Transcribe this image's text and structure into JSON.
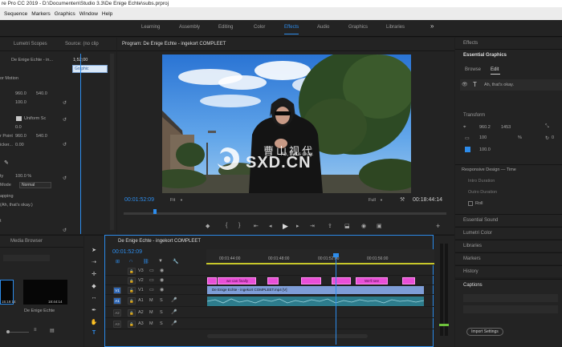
{
  "title_bar": {
    "text": "re Pro CC 2019 - D:\\Documenten\\Studio 3.3\\De Enige Echte\\subs.prproj"
  },
  "menu": [
    "Sequence",
    "Markers",
    "Graphics",
    "Window",
    "Help"
  ],
  "workspaces": [
    {
      "label": "Learning"
    },
    {
      "label": "Assembly"
    },
    {
      "label": "Editing"
    },
    {
      "label": "Color"
    },
    {
      "label": "Effects"
    },
    {
      "label": "Audio"
    },
    {
      "label": "Graphics"
    },
    {
      "label": "Libraries"
    }
  ],
  "more_glyph": "»",
  "effect_controls": {
    "tabs": [
      "Lumetri Scopes",
      "Source: (no clip"
    ],
    "clip_name": "De Enige Echte - in...",
    "timecode": "1;52;00",
    "tooltip": "Graphic",
    "rows": [
      {
        "label": "or Motion"
      },
      {
        "label": "",
        "v1": "960.0",
        "v2": "540.0"
      },
      {
        "label": "",
        "v1": "100.0"
      },
      {
        "label": "",
        "v1": ""
      },
      {
        "label": "",
        "check": "Uniform Sc"
      },
      {
        "label": "",
        "v1": "0.0"
      },
      {
        "label": "r Point",
        "v1": "960.0",
        "v2": "540.0"
      },
      {
        "label": "icker...",
        "v1": "0.00"
      },
      {
        "label": ""
      },
      {
        "label": "ty"
      },
      {
        "label": "",
        "v1": "100.0 %"
      },
      {
        "label": "Mode",
        "v1": "Normal"
      },
      {
        "label": "apping"
      },
      {
        "label": "(Ah, that's okay.)"
      },
      {
        "label": "t"
      }
    ]
  },
  "program": {
    "title": "Program: De Enige Echte - ingekort COMPLEET",
    "timecode_left": "00:01:52:09",
    "fit": "Fit",
    "quality": "Full",
    "timecode_right": "00:18:44:14",
    "watermark_main": "SXD.CN",
    "watermark_cn": "曹山视代",
    "watermark_sub": "Ah, that's okay."
  },
  "effects_panel": {
    "title": "Effects"
  },
  "essential_graphics": {
    "title": "Essential Graphics",
    "tabs": [
      "Browse",
      "Edit"
    ],
    "layer_text": "Ah, that's okay.",
    "transform_label": "Transform",
    "pos_x": "960.2",
    "pos_y": "1453",
    "rot": "0",
    "scale": "100",
    "pct": "%",
    "duration_val": "100.0",
    "responsive_label": "Responsive Design — Time",
    "intro": "Intro Duration",
    "outro": "Outro Duration",
    "roll": "Roll"
  },
  "right_list": [
    "Essential Sound",
    "Lumetri Color",
    "Libraries",
    "Markers",
    "History"
  ],
  "captions": {
    "title": "Captions",
    "import": "Import Settings"
  },
  "project_panel": {
    "tab": "Media Browser",
    "thumb1_label": "",
    "thumb2_label": "De Enige Echte",
    "thumb1_dur": "15:19:14",
    "thumb2_dur": "18:44:14"
  },
  "timeline": {
    "title": "De Enige Echte - ingekort COMPLEET",
    "timecode": "00:01:52:09",
    "ruler": [
      "00:01:44:00",
      "00:01:48:00",
      "00:01:52:00",
      "00:01:56:00"
    ],
    "tracks_v": [
      "V3",
      "V2",
      "V1"
    ],
    "tracks_a": [
      "A1",
      "A2",
      "A3"
    ],
    "clips": [
      "we can finally",
      "",
      "",
      "",
      "",
      "We'll see",
      ""
    ],
    "video_clip": "De Enige Echte - ingekort COMPLEET.mp4 [V]"
  },
  "colors": {
    "accent": "#2d8ceb",
    "caption": "#e94fd7",
    "video": "#7e9dd7",
    "audio": "#2d7c8c"
  }
}
